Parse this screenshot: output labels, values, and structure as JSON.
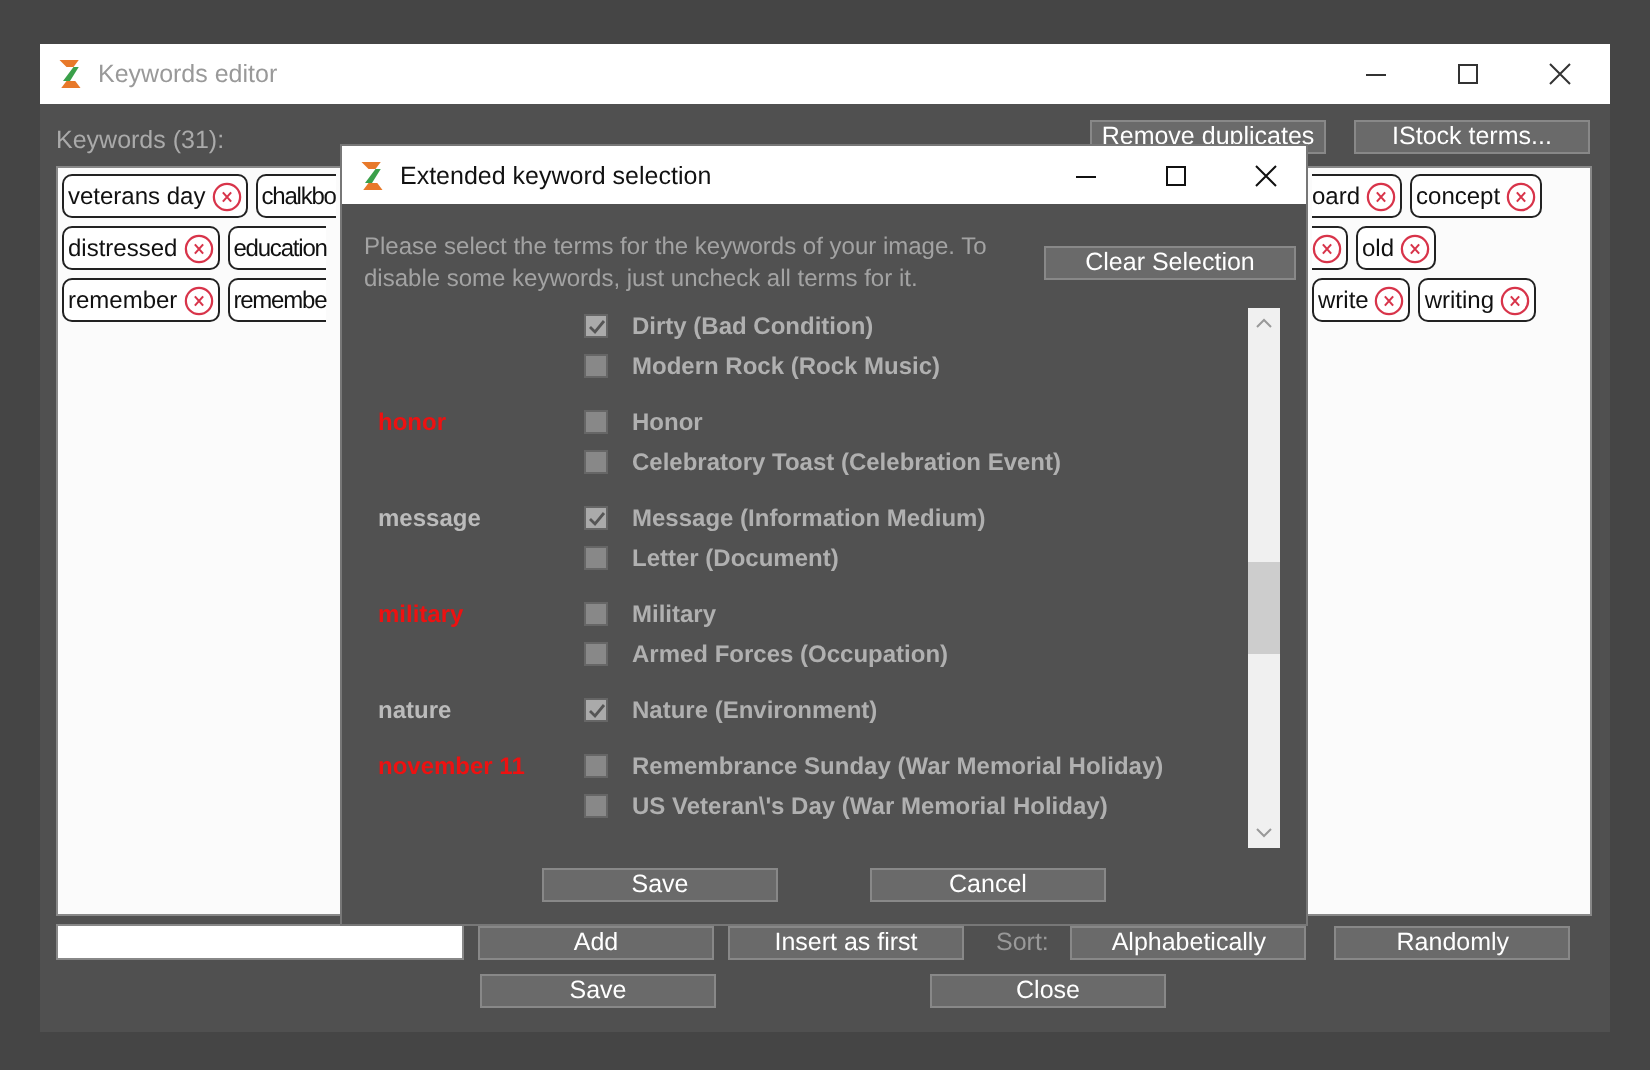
{
  "main_window": {
    "title": "Keywords editor",
    "keywords_label": "Keywords (31):",
    "top_buttons": [
      "Remove duplicates",
      "IStock terms..."
    ],
    "tag_rows": [
      {
        "left": [
          {
            "label": "veterans day",
            "kind": "whole"
          },
          {
            "label": "chalkbo",
            "kind": "cut_right"
          }
        ],
        "right": [
          {
            "label": "oard",
            "kind": "cut_left"
          },
          {
            "label": "concept",
            "kind": "whole"
          }
        ]
      },
      {
        "left": [
          {
            "label": "distressed",
            "kind": "whole"
          },
          {
            "label": "education",
            "kind": "cut_right"
          }
        ],
        "right": [
          {
            "kind": "cut_left"
          },
          {
            "label": "old",
            "kind": "whole"
          }
        ]
      },
      {
        "left": [
          {
            "label": "remember",
            "kind": "whole"
          },
          {
            "label": "remembe",
            "kind": "cut_right"
          }
        ],
        "right": [
          {
            "label": "write",
            "kind": "whole"
          },
          {
            "label": "writing",
            "kind": "whole"
          }
        ]
      }
    ],
    "add_buttons": [
      "Add",
      "Insert as first"
    ],
    "sort_label": "Sort:",
    "sort_buttons": [
      "Alphabetically",
      "Randomly"
    ],
    "footer_buttons": [
      "Save",
      "Close"
    ]
  },
  "dialog": {
    "title": "Extended keyword selection",
    "instructions": "Please select the terms for the keywords of your image. To disable some keywords, just uncheck all terms for it.",
    "clear_button": "Clear Selection",
    "groups": [
      {
        "terms": [
          {
            "label": "Dirty (Bad Condition)",
            "checked": true
          },
          {
            "label": "Modern Rock (Rock Music)",
            "checked": false
          }
        ]
      },
      {
        "keyword": "honor",
        "terms": [
          {
            "label": "Honor",
            "checked": false
          },
          {
            "label": "Celebratory Toast (Celebration Event)",
            "checked": false
          }
        ]
      },
      {
        "keyword": "message",
        "terms": [
          {
            "label": "Message (Information Medium)",
            "checked": true
          },
          {
            "label": "Letter (Document)",
            "checked": false
          }
        ]
      },
      {
        "keyword": "military",
        "terms": [
          {
            "label": "Military",
            "checked": false
          },
          {
            "label": "Armed Forces (Occupation)",
            "checked": false
          }
        ]
      },
      {
        "keyword": "nature",
        "terms": [
          {
            "label": "Nature (Environment)",
            "checked": true
          }
        ]
      },
      {
        "keyword": "november 11",
        "terms": [
          {
            "label": "Remembrance Sunday (War Memorial Holiday)",
            "checked": false
          },
          {
            "label": "US Veteran\\'s Day (War Memorial Holiday)",
            "checked": false
          }
        ]
      }
    ],
    "buttons": [
      "Save",
      "Cancel"
    ]
  }
}
